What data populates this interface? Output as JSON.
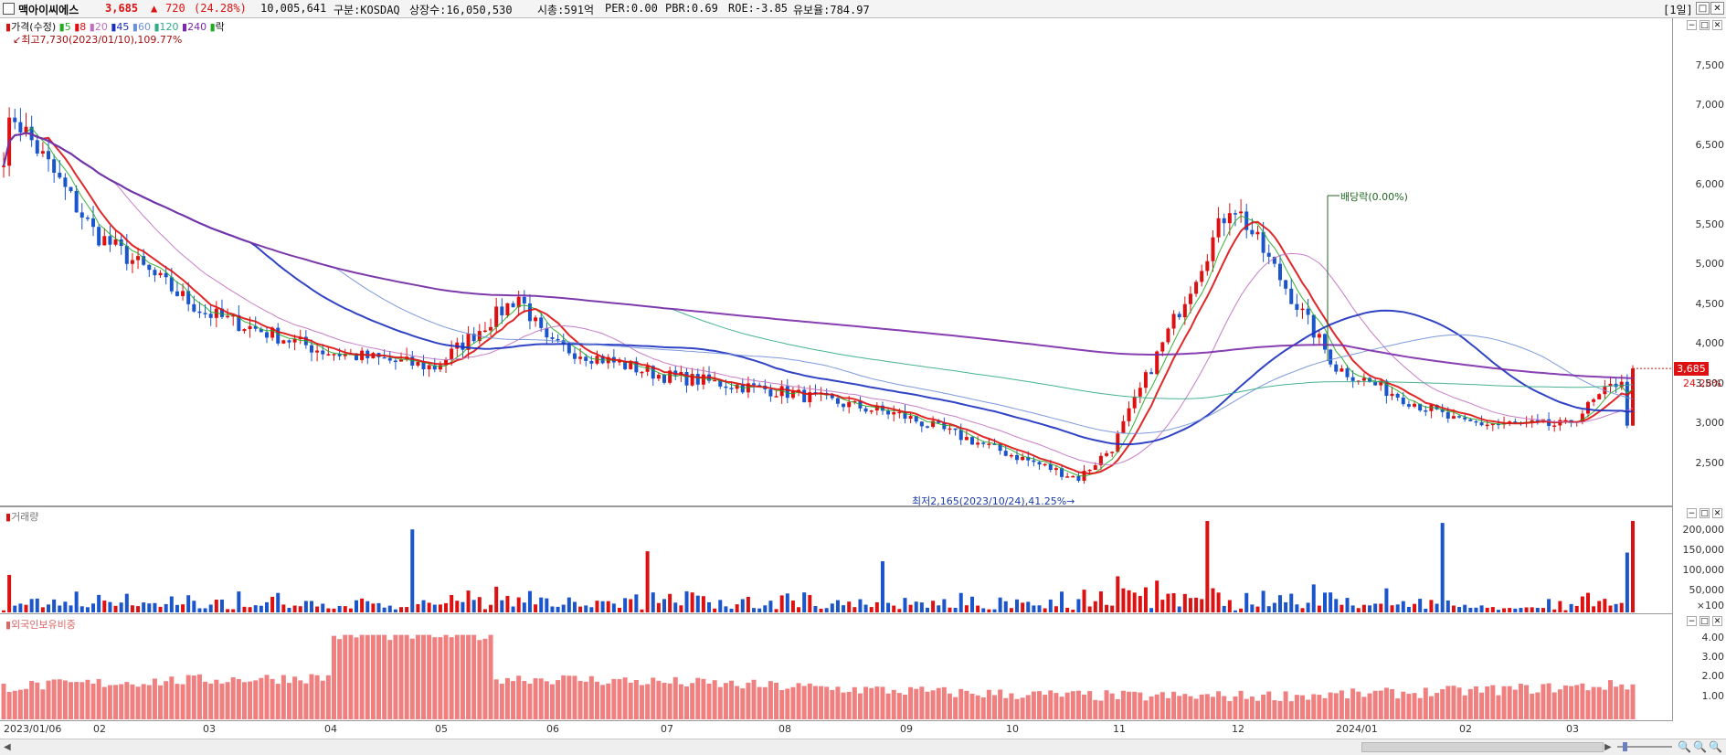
{
  "header": {
    "stock_name": "맥아이씨에스",
    "price": "3,685",
    "change_arrow": "▲",
    "change": "720",
    "change_pct": "(24.28%)",
    "volume": "10,005,641",
    "market": "구분:KOSDAQ",
    "listed_shares": "상장수:16,050,530",
    "market_cap": "시총:591억",
    "per": "PER:0.00",
    "pbr": "PBR:0.69",
    "roe": "ROE:-3.85",
    "retention": "유보율:784.97",
    "period_label": "[1일]",
    "colors": {
      "up": "#dd1111",
      "down": "#1a55cc"
    }
  },
  "price_panel": {
    "legend": {
      "title": "가격(수정)",
      "ma": [
        {
          "label": "5",
          "color": "#22aa22"
        },
        {
          "label": "8",
          "color": "#dd1111"
        },
        {
          "label": "20",
          "color": "#c070c0"
        },
        {
          "label": "45",
          "color": "#1a2fbf"
        },
        {
          "label": "60",
          "color": "#6f8fd8"
        },
        {
          "label": "120",
          "color": "#33aa88"
        },
        {
          "label": "240",
          "color": "#7a2aa8"
        }
      ],
      "ex_label": "락"
    },
    "high_note": "최고7,730(2023/01/10),109.77%",
    "low_note": "최저2,165(2023/10/24),41.25%",
    "dividend_note": "배당락(0.00%)",
    "current_tag": "3,685",
    "current_pct": "24.28%",
    "y_ticks": [
      "7,500",
      "7,000",
      "6,500",
      "6,000",
      "5,500",
      "5,000",
      "4,500",
      "4,000",
      "3,500",
      "3,000",
      "2,500"
    ]
  },
  "volume_panel": {
    "title": "거래량",
    "y_ticks": [
      "200,000",
      "150,000",
      "100,000",
      "50,000",
      "×100"
    ]
  },
  "foreign_panel": {
    "title": "외국인보유비중",
    "y_ticks": [
      "4.00",
      "3.00",
      "2.00",
      "1.00"
    ]
  },
  "x_axis": {
    "labels": [
      "2023/01/06",
      "02",
      "03",
      "04",
      "05",
      "06",
      "07",
      "08",
      "09",
      "10",
      "11",
      "12",
      "2024/01",
      "02",
      "03"
    ]
  },
  "chart_data": {
    "type": "candlestick",
    "unit": "KRW",
    "ylim": [
      2165,
      7730
    ],
    "anchors": [
      {
        "date": "2023/01/06",
        "close": 6400
      },
      {
        "date": "2023/01/10",
        "close": 6900,
        "high": 7730
      },
      {
        "date": "2023/02",
        "close": 5400
      },
      {
        "date": "2023/03",
        "close": 4400
      },
      {
        "date": "2023/04",
        "close": 3900
      },
      {
        "date": "2023/05",
        "close": 3700
      },
      {
        "date": "2023/05/26",
        "close": 4600
      },
      {
        "date": "2023/06",
        "close": 4000
      },
      {
        "date": "2023/07",
        "close": 3600
      },
      {
        "date": "2023/08",
        "close": 3400
      },
      {
        "date": "2023/09",
        "close": 3100
      },
      {
        "date": "2023/10/24",
        "close": 2300,
        "low": 2165
      },
      {
        "date": "2023/11",
        "close": 2700
      },
      {
        "date": "2023/12/05",
        "close": 5800,
        "high": 6250
      },
      {
        "date": "2024/01",
        "close": 3700
      },
      {
        "date": "2024/02",
        "close": 3000
      },
      {
        "date": "2024/03",
        "close": 2965
      },
      {
        "date": "2024/03/latest",
        "close": 3685
      }
    ]
  }
}
